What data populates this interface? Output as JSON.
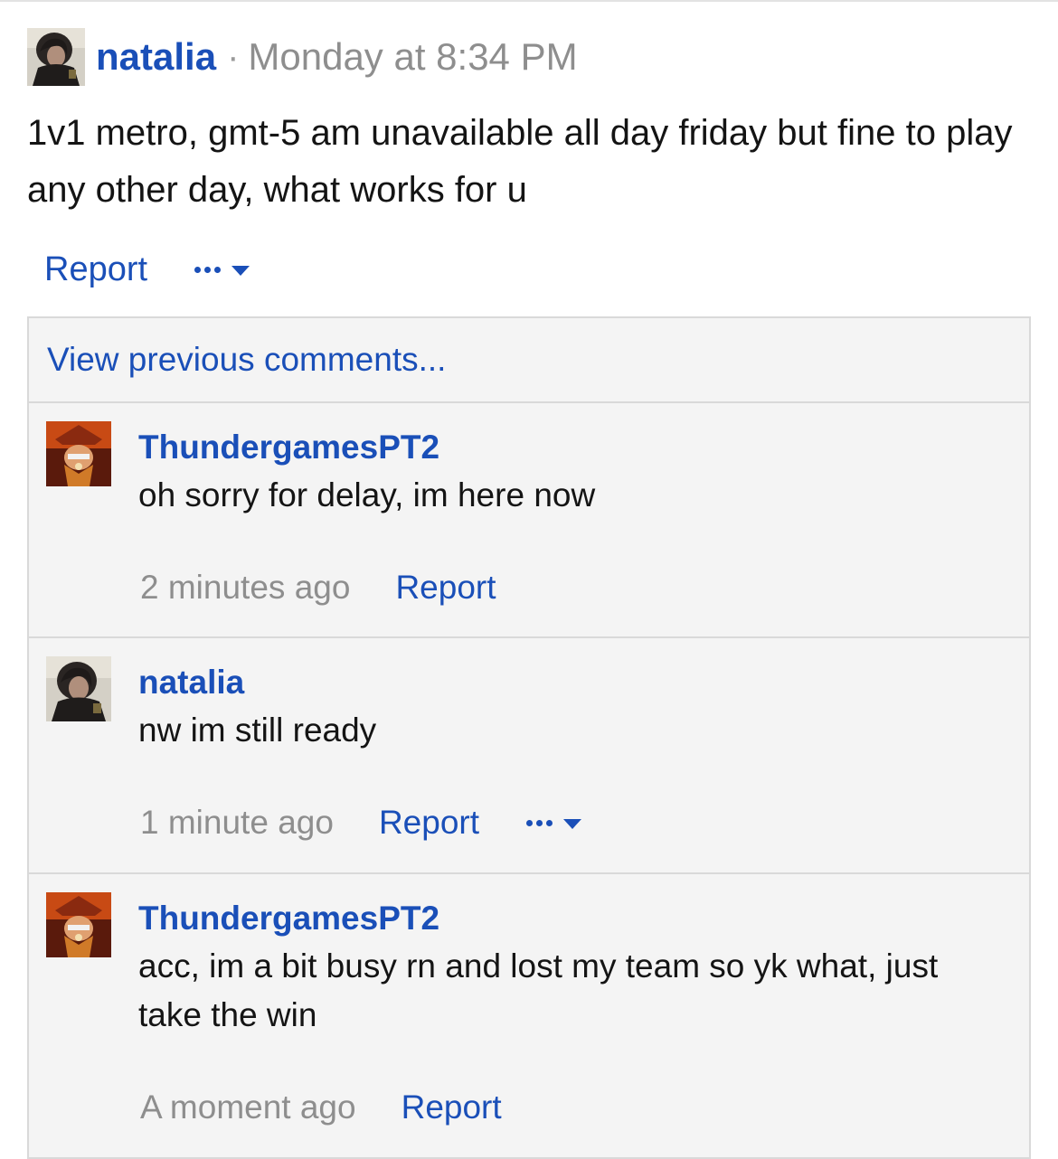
{
  "post": {
    "author": "natalia",
    "separator": "·",
    "time": "Monday at 8:34 PM",
    "text": "1v1 metro, gmt-5 am unavailable all day friday but fine to play any other day, what works for u",
    "report_label": "Report",
    "avatar_icon": "user-avatar-natalia"
  },
  "comments": {
    "view_previous": "View previous comments...",
    "items": [
      {
        "author": "ThundergamesPT2",
        "text": "oh sorry for delay, im here now",
        "time": "2 minutes ago",
        "report_label": "Report",
        "has_more_menu": false,
        "avatar_icon": "user-avatar-thundergames"
      },
      {
        "author": "natalia",
        "text": "nw im still ready",
        "time": "1 minute ago",
        "report_label": "Report",
        "has_more_menu": true,
        "avatar_icon": "user-avatar-natalia"
      },
      {
        "author": "ThundergamesPT2",
        "text": "acc, im a bit busy rn and lost my team so yk what, just take the win",
        "time": "A moment ago",
        "report_label": "Report",
        "has_more_menu": false,
        "avatar_icon": "user-avatar-thundergames"
      }
    ]
  },
  "colors": {
    "link": "#1a4fb8",
    "muted": "#8e8e8e",
    "panel_bg": "#f4f4f4",
    "panel_border": "#d9d9d9"
  }
}
